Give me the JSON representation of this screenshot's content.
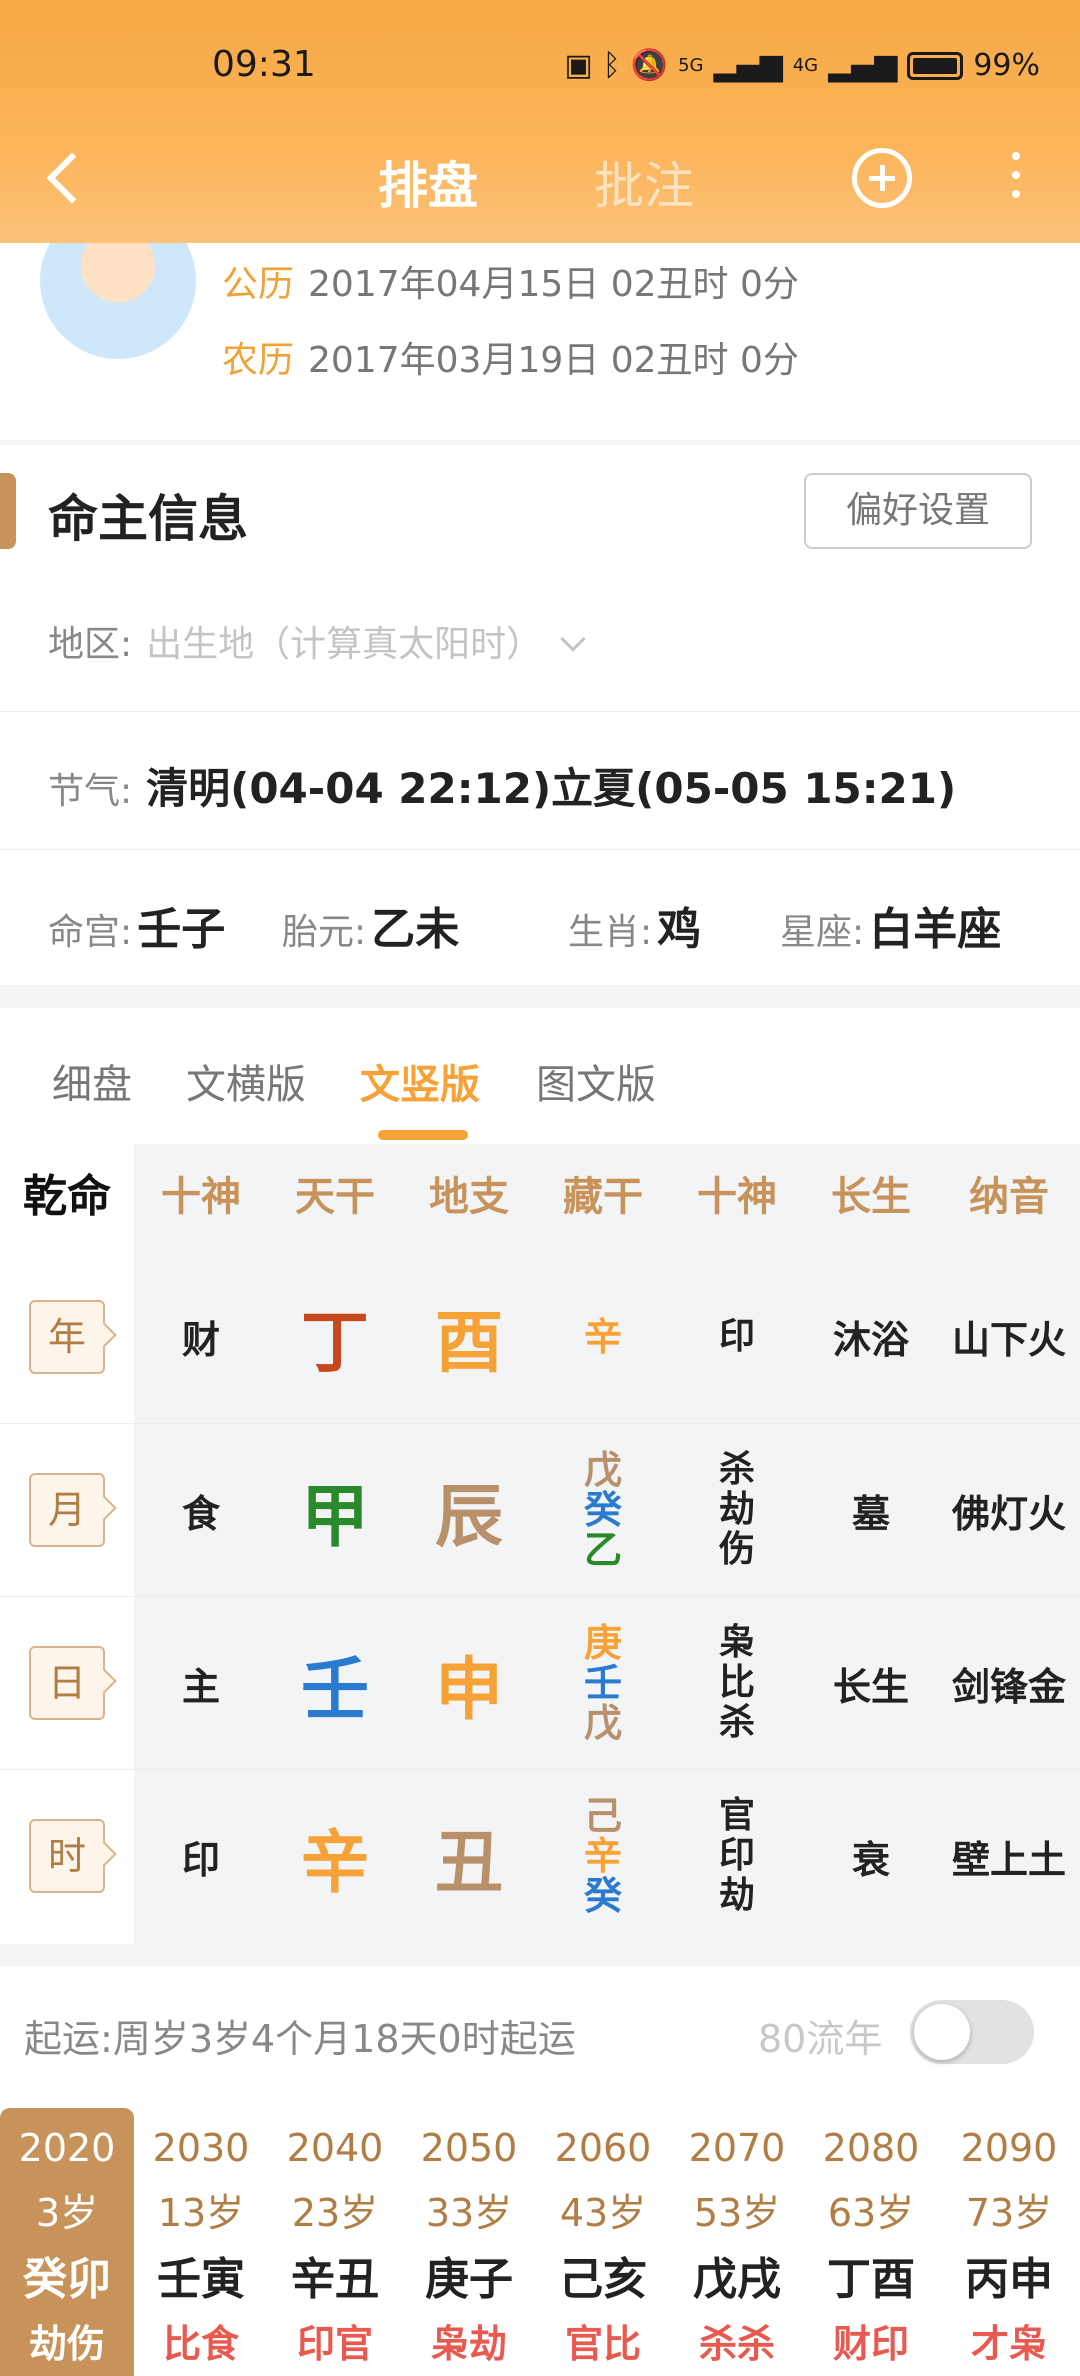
{
  "status_bar": {
    "time": "09:31",
    "battery": "99%",
    "network_1": "5G",
    "network_2": "4G"
  },
  "nav": {
    "tab_main": "排盘",
    "tab_second": "批注"
  },
  "dates": {
    "solar_label": "公历",
    "solar_value": "2017年04月15日 02丑时 0分",
    "lunar_label": "农历",
    "lunar_value": "2017年03月19日 02丑时 0分"
  },
  "info": {
    "title": "命主信息",
    "pref_button": "偏好设置",
    "region_label": "地区:",
    "region_placeholder": "出生地（计算真太阳时）",
    "solar_term_label": "节气:",
    "solar_term_value": "清明(04-04 22:12)立夏(05-05 15:21)",
    "minggong_label": "命宫:",
    "minggong_value": "壬子",
    "taiyuan_label": "胎元:",
    "taiyuan_value": "乙未",
    "zodiac_label": "生肖:",
    "zodiac_value": "鸡",
    "star_label": "星座:",
    "star_value": "白羊座"
  },
  "tabs": [
    "细盘",
    "文横版",
    "文竖版",
    "图文版"
  ],
  "active_tab": "文竖版",
  "chart": {
    "corner": "乾命",
    "headers": [
      "十神",
      "天干",
      "地支",
      "藏干",
      "十神",
      "长生",
      "纳音"
    ],
    "rows": [
      {
        "pillar": "年",
        "shishen": "财",
        "tiangan": "丁",
        "tiangan_color": "#c8481e",
        "dizhi": "酉",
        "dizhi_color": "#f6a236",
        "canggan": [
          {
            "c": "辛",
            "color": "#f6a236"
          }
        ],
        "shishen2": [
          "印"
        ],
        "changsheng": "沐浴",
        "nayin": "山下火"
      },
      {
        "pillar": "月",
        "shishen": "食",
        "tiangan": "甲",
        "tiangan_color": "#2a8a2a",
        "dizhi": "辰",
        "dizhi_color": "#b8906a",
        "canggan": [
          {
            "c": "戊",
            "color": "#b8906a"
          },
          {
            "c": "癸",
            "color": "#2a7bd0"
          },
          {
            "c": "乙",
            "color": "#2a8a2a"
          }
        ],
        "shishen2": [
          "杀",
          "劫",
          "伤"
        ],
        "changsheng": "墓",
        "nayin": "佛灯火"
      },
      {
        "pillar": "日",
        "shishen": "主",
        "tiangan": "壬",
        "tiangan_color": "#2a7bd0",
        "dizhi": "申",
        "dizhi_color": "#f6a236",
        "canggan": [
          {
            "c": "庚",
            "color": "#f6a236"
          },
          {
            "c": "壬",
            "color": "#2a7bd0"
          },
          {
            "c": "戊",
            "color": "#b8906a"
          }
        ],
        "shishen2": [
          "枭",
          "比",
          "杀"
        ],
        "changsheng": "长生",
        "nayin": "剑锋金"
      },
      {
        "pillar": "时",
        "shishen": "印",
        "tiangan": "辛",
        "tiangan_color": "#f6a236",
        "dizhi": "丑",
        "dizhi_color": "#b8906a",
        "canggan": [
          {
            "c": "己",
            "color": "#b8906a"
          },
          {
            "c": "辛",
            "color": "#f6a236"
          },
          {
            "c": "癸",
            "color": "#2a7bd0"
          }
        ],
        "shishen2": [
          "官",
          "印",
          "劫"
        ],
        "changsheng": "衰",
        "nayin": "壁上土"
      }
    ]
  },
  "luck": {
    "label": "起运:",
    "value": "周岁3岁4个月18天0时起运",
    "flow_label": "80流年",
    "flow_enabled": false,
    "decades": [
      {
        "year": "2020",
        "age": "3岁",
        "ganzhi": "癸卯",
        "shishen": "劫伤"
      },
      {
        "year": "2030",
        "age": "13岁",
        "ganzhi": "壬寅",
        "shishen": "比食"
      },
      {
        "year": "2040",
        "age": "23岁",
        "ganzhi": "辛丑",
        "shishen": "印官"
      },
      {
        "year": "2050",
        "age": "33岁",
        "ganzhi": "庚子",
        "shishen": "枭劫"
      },
      {
        "year": "2060",
        "age": "43岁",
        "ganzhi": "己亥",
        "shishen": "官比"
      },
      {
        "year": "2070",
        "age": "53岁",
        "ganzhi": "戊戌",
        "shishen": "杀杀"
      },
      {
        "year": "2080",
        "age": "63岁",
        "ganzhi": "丁酉",
        "shishen": "财印"
      },
      {
        "year": "2090",
        "age": "73岁",
        "ganzhi": "丙申",
        "shishen": "才枭"
      }
    ]
  },
  "colors": {
    "accent": "#f6a236",
    "brown": "#c8935a",
    "header_top": "#f7a845"
  }
}
